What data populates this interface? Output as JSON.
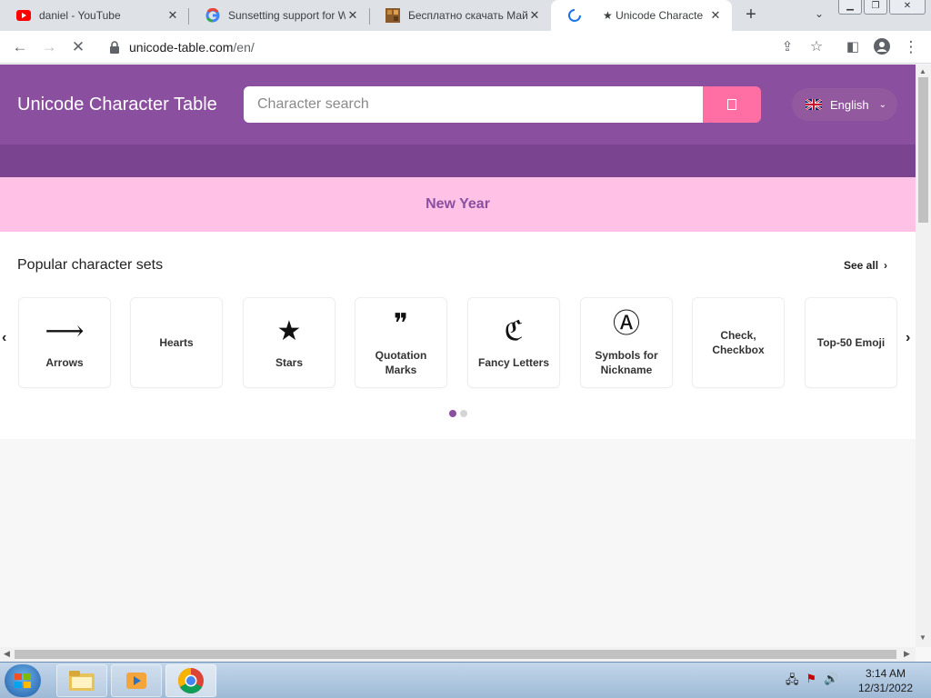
{
  "browser": {
    "tabs": [
      {
        "title": "daniel - YouTube",
        "icon": "youtube-icon"
      },
      {
        "title": "Sunsetting support for W",
        "icon": "google-icon"
      },
      {
        "title": "Бесплатно скачать Майн",
        "icon": "minecraft-icon"
      },
      {
        "title": "★ Unicode Characte",
        "icon": "loading-spinner-icon",
        "active": true
      }
    ],
    "new_tab_label": "+",
    "url_host": "unicode-table.com",
    "url_path": "/en/"
  },
  "site": {
    "brand": "Unicode Character Table",
    "search_placeholder": "Character search",
    "language": "English",
    "banner": "New Year",
    "colors": {
      "header": "#8a4f9f",
      "search_button": "#ff6fa3",
      "banner": "#ffc1e6"
    }
  },
  "popular": {
    "title": "Popular character sets",
    "see_all": "See all",
    "cards": [
      {
        "glyph": "⟶",
        "label": "Arrows"
      },
      {
        "glyph": "",
        "label": "Hearts"
      },
      {
        "glyph": "★",
        "label": "Stars"
      },
      {
        "glyph": "❞",
        "label": "Quotation Marks"
      },
      {
        "glyph": "ℭ",
        "label": "Fancy Letters"
      },
      {
        "glyph": "Ⓐ",
        "label": "Symbols for Nickname"
      },
      {
        "glyph": "",
        "label": "Check, Checkbox"
      },
      {
        "glyph": "",
        "label": "Top-50 Emoji"
      }
    ],
    "pager": {
      "current": 1,
      "total": 2
    }
  },
  "taskbar": {
    "time": "3:14 AM",
    "date": "12/31/2022"
  }
}
